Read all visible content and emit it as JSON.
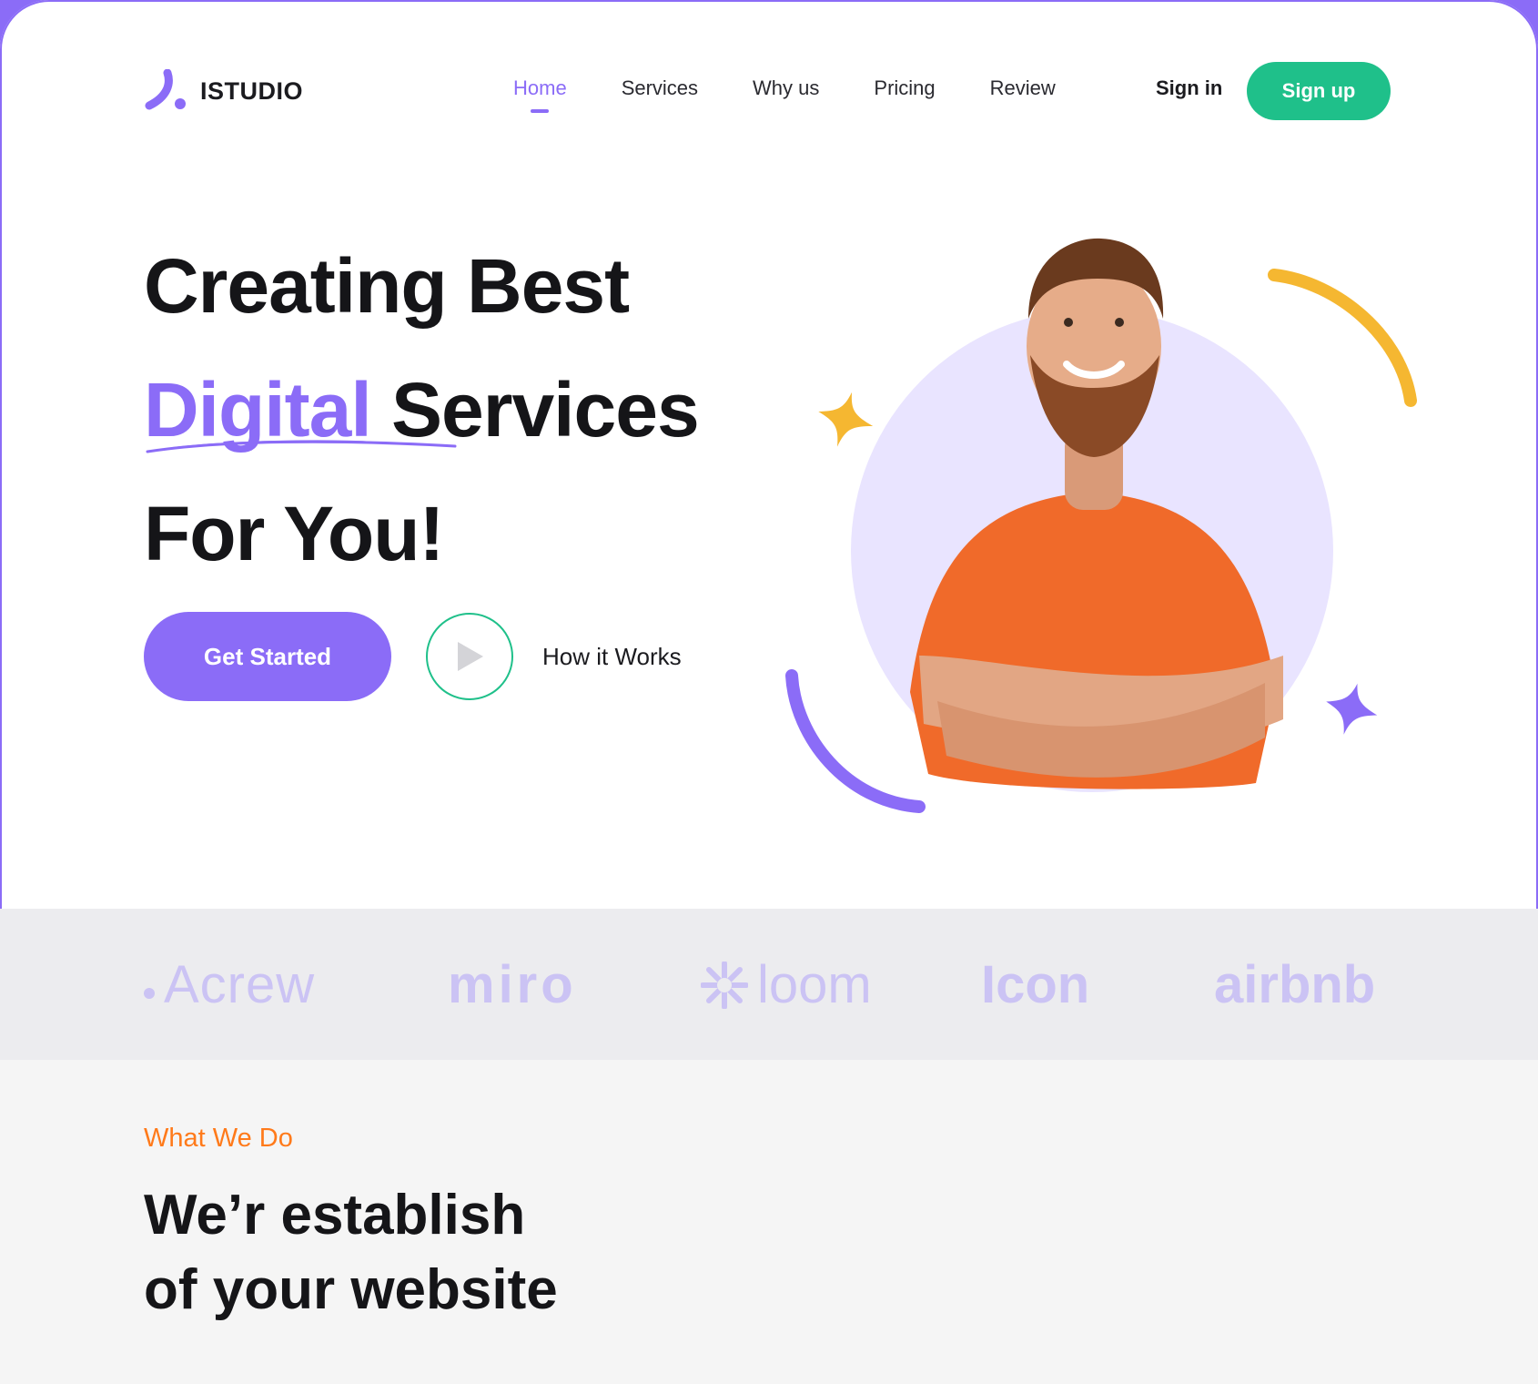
{
  "brand": {
    "name": "ISTUDIO"
  },
  "nav": {
    "items": [
      {
        "label": "Home",
        "active": true
      },
      {
        "label": "Services"
      },
      {
        "label": "Why us"
      },
      {
        "label": "Pricing"
      },
      {
        "label": "Review"
      }
    ],
    "signin_label": "Sign in",
    "signup_label": "Sign up"
  },
  "hero": {
    "line1": "Creating Best",
    "line2_accent": "Digital",
    "line2_rest": "Services",
    "line3": "For You!",
    "cta_label": "Get Started",
    "how_label": "How it Works"
  },
  "partners": {
    "acrew": "Acrew",
    "miro": "miro",
    "loom": "loom",
    "icon": "Icon",
    "airbnb": "airbnb"
  },
  "what_we_do": {
    "eyebrow": "What We Do",
    "title_line1": "We’r establish",
    "title_line2": "of your website"
  },
  "colors": {
    "purple": "#8b6cf7",
    "green": "#1fc08a",
    "orange": "#ff7a1a",
    "yellow": "#f5b731",
    "lavender": "#e9e4ff"
  }
}
